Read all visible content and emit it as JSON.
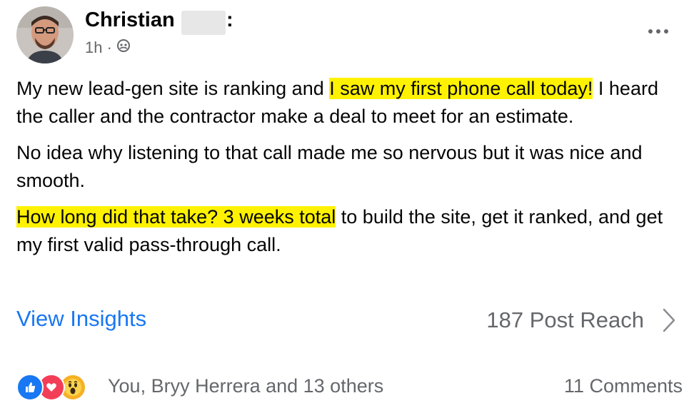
{
  "post": {
    "author": "Christian",
    "author_suffix": ":",
    "timestamp": "1h ·",
    "audience_icon": "friends-icon",
    "paragraphs": [
      {
        "before": "My new lead-gen site is ranking and ",
        "highlight": "I saw my first phone call today!",
        "after": " I heard the caller and the contractor make a deal to meet for an estimate."
      },
      {
        "before": "No idea why listening to that call made me so nervous but it was nice and smooth.",
        "highlight": "",
        "after": ""
      },
      {
        "before": "",
        "highlight": "How long did that take?  3 weeks total",
        "after": " to build the site, get it ranked, and get my first valid pass-through call."
      }
    ],
    "highlight_color": "#fff200"
  },
  "insights": {
    "link_label": "View Insights",
    "reach_label": "187 Post Reach"
  },
  "reactions": {
    "icons": [
      "like-icon",
      "love-icon",
      "wow-icon"
    ],
    "summary": "You, Bryy Herrera and 13 others",
    "comments": "11 Comments"
  },
  "colors": {
    "accent": "#1877f2",
    "secondary_text": "#65676b"
  }
}
